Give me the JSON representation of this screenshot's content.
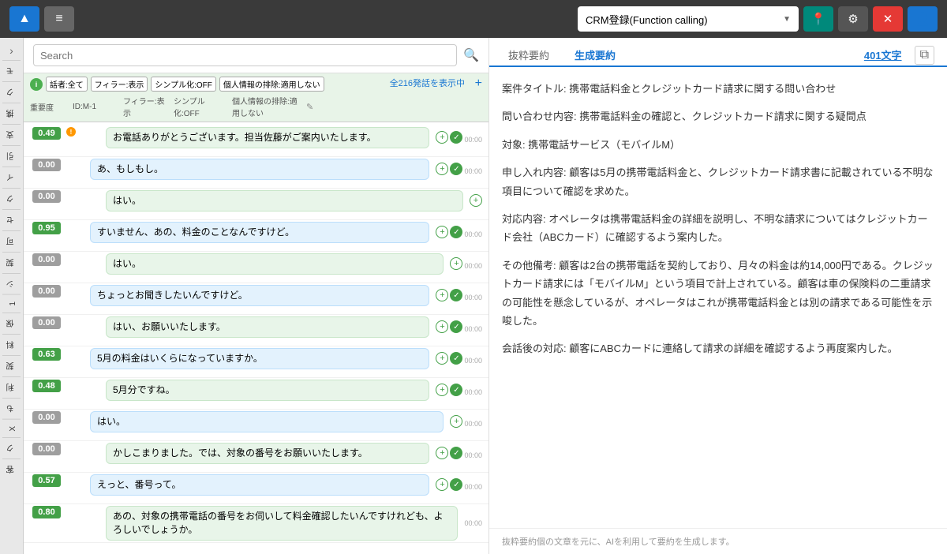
{
  "toolbar": {
    "upload_label": "▲",
    "list_label": "≡",
    "crm_dropdown_value": "CRM登録(Function calling)",
    "location_icon": "📍",
    "gear_icon": "⚙",
    "close_icon": "✕",
    "user_icon": "👤"
  },
  "search": {
    "placeholder": "Search"
  },
  "filter": {
    "badge": "i",
    "show_all": "全216発話を表示中",
    "add_col": "+",
    "edit_icon": "✎",
    "tags": [
      {
        "label": "話者:全て"
      },
      {
        "label": "フィラー:表示"
      },
      {
        "label": "シンプル化:OFF"
      },
      {
        "label": "個人情報の排除:適用しない"
      }
    ],
    "col_headers": [
      {
        "label": "重要度",
        "key": "importance"
      },
      {
        "label": "ID:M-1",
        "key": "id"
      },
      {
        "label": "フィラー:表示",
        "key": "filler"
      },
      {
        "label": "シンプル化:OFF",
        "key": "simple"
      },
      {
        "label": "個人情報の排除:適用しない",
        "key": "personal"
      }
    ]
  },
  "utterances": [
    {
      "score": "0.49",
      "score_class": "score-green",
      "has_orange_dot": true,
      "time": "00:00",
      "text": "お電話ありがとうございます。担当佐藤がご案内いたします。",
      "speaker": "operator",
      "has_check": true,
      "has_plus": true
    },
    {
      "score": "0.00",
      "score_class": "score-gray",
      "has_orange_dot": false,
      "time": "00:00",
      "text": "あ、もしもし。",
      "speaker": "customer",
      "has_check": true,
      "has_plus": true
    },
    {
      "score": "0.00",
      "score_class": "score-gray",
      "has_orange_dot": false,
      "time": "",
      "text": "はい。",
      "speaker": "operator",
      "has_check": false,
      "has_plus": true
    },
    {
      "score": "0.95",
      "score_class": "score-green",
      "has_orange_dot": false,
      "time": "00:00",
      "text": "すいません、あの、料金のことなんですけど。",
      "speaker": "customer",
      "has_check": true,
      "has_plus": true
    },
    {
      "score": "0.00",
      "score_class": "score-gray",
      "has_orange_dot": false,
      "time": "00:00",
      "text": "はい。",
      "speaker": "operator",
      "has_check": false,
      "has_plus": true
    },
    {
      "score": "0.00",
      "score_class": "score-gray",
      "has_orange_dot": false,
      "time": "00:00",
      "text": "ちょっとお聞きしたいんですけど。",
      "speaker": "customer",
      "has_check": true,
      "has_plus": true
    },
    {
      "score": "0.00",
      "score_class": "score-gray",
      "has_orange_dot": false,
      "time": "00:00",
      "text": "はい、お願いいたします。",
      "speaker": "operator",
      "has_check": true,
      "has_plus": true
    },
    {
      "score": "0.63",
      "score_class": "score-green",
      "has_orange_dot": false,
      "time": "00:00",
      "text": "5月の料金はいくらになっていますか。",
      "speaker": "customer",
      "has_check": true,
      "has_plus": true
    },
    {
      "score": "0.48",
      "score_class": "score-green",
      "has_orange_dot": false,
      "time": "00:00",
      "text": "5月分ですね。",
      "speaker": "operator",
      "has_check": true,
      "has_plus": true
    },
    {
      "score": "0.00",
      "score_class": "score-gray",
      "has_orange_dot": false,
      "time": "00:00",
      "text": "はい。",
      "speaker": "customer",
      "has_check": false,
      "has_plus": true
    },
    {
      "score": "0.00",
      "score_class": "score-gray",
      "has_orange_dot": false,
      "time": "00:00",
      "text": "かしこまりました。では、対象の番号をお願いいたします。",
      "speaker": "operator",
      "has_check": true,
      "has_plus": true
    },
    {
      "score": "0.57",
      "score_class": "score-green",
      "has_orange_dot": false,
      "time": "00:00",
      "text": "えっと、番号って。",
      "speaker": "customer",
      "has_check": true,
      "has_plus": true
    },
    {
      "score": "0.80",
      "score_class": "score-green",
      "has_orange_dot": false,
      "time": "00:00",
      "text": "あの、対象の携帯電話の番号をお伺いして料金確認したいんですけれども、よろしいでしょうか。",
      "speaker": "operator",
      "has_check": false,
      "has_plus": false
    }
  ],
  "right_panel": {
    "tab_extract": "抜粋要約",
    "tab_generate": "生成要約",
    "char_count": "401文字",
    "copy_icon": "⧉",
    "summary_paragraphs": [
      "案件タイトル: 携帯電話料金とクレジットカード請求に関する問い合わせ",
      "問い合わせ内容: 携帯電話料金の確認と、クレジットカード請求に関する疑問点",
      "対象: 携帯電話サービス（モバイルM）",
      "申し入れ内容: 顧客は5月の携帯電話料金と、クレジットカード請求書に記載されている不明な項目について確認を求めた。",
      "対応内容: オペレータは携帯電話料金の詳細を説明し、不明な請求についてはクレジットカード会社（ABCカード）に確認するよう案内した。",
      "その他備考: 顧客は2台の携帯電話を契約しており、月々の料金は約14,000円である。クレジットカード請求には「モバイルM」という項目で計上されている。顧客は車の保険料の二重請求の可能性を懸念しているが、オペレータはこれが携帯電話料金とは別の請求である可能性を示唆した。",
      "会話後の対応: 顧客にABCカードに連絡して請求の詳細を確認するよう再度案内した。"
    ],
    "footer_text": "抜粋要約個の文章を元に、AIを利用して要約を生成します。"
  },
  "left_sidebar_tabs": [
    {
      "label": "モ"
    },
    {
      "label": "ク"
    },
    {
      "label": "携"
    },
    {
      "label": "支"
    },
    {
      "label": "引"
    },
    {
      "label": "イ"
    },
    {
      "label": "ク"
    },
    {
      "label": "セ"
    },
    {
      "label": "可"
    },
    {
      "label": "契"
    },
    {
      "label": "シ"
    },
    {
      "label": "1"
    },
    {
      "label": "保"
    },
    {
      "label": "料"
    },
    {
      "label": "契"
    },
    {
      "label": "利"
    },
    {
      "label": "も"
    },
    {
      "label": "X"
    },
    {
      "label": "ク"
    },
    {
      "label": "客"
    }
  ]
}
